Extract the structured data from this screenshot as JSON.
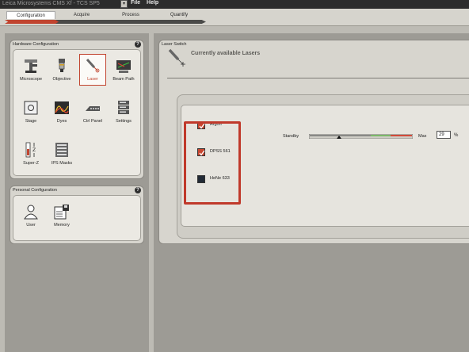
{
  "window": {
    "app_title": "Leica Microsystems CMS Xf - TCS SP5",
    "dropdown_glyph": "▾",
    "menu": [
      "File",
      "Help"
    ]
  },
  "workflow_tabs": [
    {
      "label": "Configuration",
      "active": true
    },
    {
      "label": "Acquire",
      "active": false
    },
    {
      "label": "Process",
      "active": false
    },
    {
      "label": "Quantify",
      "active": false
    }
  ],
  "hardware_panel": {
    "title": "Hardware Configuration",
    "help": "?",
    "tools": [
      {
        "label": "Microscope",
        "icon": "microscope-icon"
      },
      {
        "label": "Objective",
        "icon": "objective-icon"
      },
      {
        "label": "Laser",
        "icon": "laser-icon",
        "active": true
      },
      {
        "label": "Beam Path",
        "icon": "beam-path-icon"
      },
      {
        "label": "Stage",
        "icon": "stage-icon"
      },
      {
        "label": "Dyes",
        "icon": "dyes-icon"
      },
      {
        "label": "Ctrl Panel",
        "icon": "ctrl-panel-icon"
      },
      {
        "label": "Settings",
        "icon": "settings-icon"
      },
      {
        "label": "Super-Z",
        "icon": "super-z-icon"
      },
      {
        "label": "IPS Masks",
        "icon": "ips-masks-icon"
      }
    ]
  },
  "personal_panel": {
    "title": "Personal Configuration",
    "help": "?",
    "tools": [
      {
        "label": "User",
        "icon": "user-icon"
      },
      {
        "label": "Memory",
        "icon": "memory-icon"
      }
    ]
  },
  "laser_switch": {
    "title": "Laser Switch",
    "heading": "Currently available Lasers",
    "lasers": [
      {
        "name": "Argon",
        "checked": true
      },
      {
        "name": "DPSS 561",
        "checked": true
      },
      {
        "name": "HeNe 633",
        "checked": false
      }
    ],
    "power": {
      "min_label": "Standby",
      "max_label": "Max",
      "value": "29",
      "unit": "%",
      "slider_fraction": 0.29
    }
  },
  "colors": {
    "accent": "#c1442f",
    "panel_bg": "#d7d5ce",
    "dark_chrome": "#2c2c2c"
  }
}
